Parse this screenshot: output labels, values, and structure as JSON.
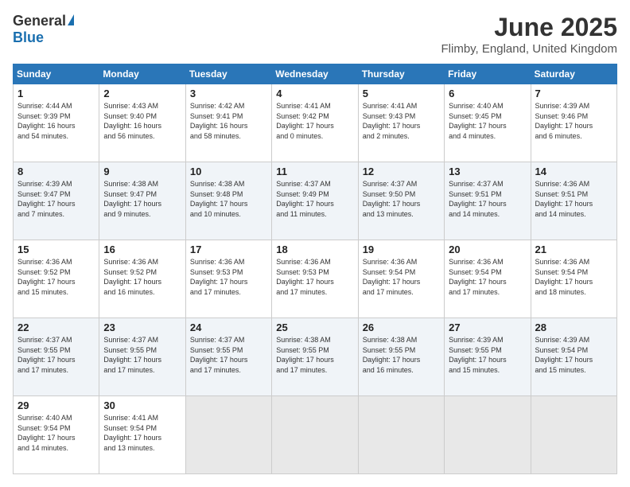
{
  "header": {
    "logo_general": "General",
    "logo_blue": "Blue",
    "title": "June 2025",
    "location": "Flimby, England, United Kingdom"
  },
  "columns": [
    "Sunday",
    "Monday",
    "Tuesday",
    "Wednesday",
    "Thursday",
    "Friday",
    "Saturday"
  ],
  "weeks": [
    [
      {
        "day": "1",
        "text": "Sunrise: 4:44 AM\nSunset: 9:39 PM\nDaylight: 16 hours\nand 54 minutes."
      },
      {
        "day": "2",
        "text": "Sunrise: 4:43 AM\nSunset: 9:40 PM\nDaylight: 16 hours\nand 56 minutes."
      },
      {
        "day": "3",
        "text": "Sunrise: 4:42 AM\nSunset: 9:41 PM\nDaylight: 16 hours\nand 58 minutes."
      },
      {
        "day": "4",
        "text": "Sunrise: 4:41 AM\nSunset: 9:42 PM\nDaylight: 17 hours\nand 0 minutes."
      },
      {
        "day": "5",
        "text": "Sunrise: 4:41 AM\nSunset: 9:43 PM\nDaylight: 17 hours\nand 2 minutes."
      },
      {
        "day": "6",
        "text": "Sunrise: 4:40 AM\nSunset: 9:45 PM\nDaylight: 17 hours\nand 4 minutes."
      },
      {
        "day": "7",
        "text": "Sunrise: 4:39 AM\nSunset: 9:46 PM\nDaylight: 17 hours\nand 6 minutes."
      }
    ],
    [
      {
        "day": "8",
        "text": "Sunrise: 4:39 AM\nSunset: 9:47 PM\nDaylight: 17 hours\nand 7 minutes."
      },
      {
        "day": "9",
        "text": "Sunrise: 4:38 AM\nSunset: 9:47 PM\nDaylight: 17 hours\nand 9 minutes."
      },
      {
        "day": "10",
        "text": "Sunrise: 4:38 AM\nSunset: 9:48 PM\nDaylight: 17 hours\nand 10 minutes."
      },
      {
        "day": "11",
        "text": "Sunrise: 4:37 AM\nSunset: 9:49 PM\nDaylight: 17 hours\nand 11 minutes."
      },
      {
        "day": "12",
        "text": "Sunrise: 4:37 AM\nSunset: 9:50 PM\nDaylight: 17 hours\nand 13 minutes."
      },
      {
        "day": "13",
        "text": "Sunrise: 4:37 AM\nSunset: 9:51 PM\nDaylight: 17 hours\nand 14 minutes."
      },
      {
        "day": "14",
        "text": "Sunrise: 4:36 AM\nSunset: 9:51 PM\nDaylight: 17 hours\nand 14 minutes."
      }
    ],
    [
      {
        "day": "15",
        "text": "Sunrise: 4:36 AM\nSunset: 9:52 PM\nDaylight: 17 hours\nand 15 minutes."
      },
      {
        "day": "16",
        "text": "Sunrise: 4:36 AM\nSunset: 9:52 PM\nDaylight: 17 hours\nand 16 minutes."
      },
      {
        "day": "17",
        "text": "Sunrise: 4:36 AM\nSunset: 9:53 PM\nDaylight: 17 hours\nand 17 minutes."
      },
      {
        "day": "18",
        "text": "Sunrise: 4:36 AM\nSunset: 9:53 PM\nDaylight: 17 hours\nand 17 minutes."
      },
      {
        "day": "19",
        "text": "Sunrise: 4:36 AM\nSunset: 9:54 PM\nDaylight: 17 hours\nand 17 minutes."
      },
      {
        "day": "20",
        "text": "Sunrise: 4:36 AM\nSunset: 9:54 PM\nDaylight: 17 hours\nand 17 minutes."
      },
      {
        "day": "21",
        "text": "Sunrise: 4:36 AM\nSunset: 9:54 PM\nDaylight: 17 hours\nand 18 minutes."
      }
    ],
    [
      {
        "day": "22",
        "text": "Sunrise: 4:37 AM\nSunset: 9:55 PM\nDaylight: 17 hours\nand 17 minutes."
      },
      {
        "day": "23",
        "text": "Sunrise: 4:37 AM\nSunset: 9:55 PM\nDaylight: 17 hours\nand 17 minutes."
      },
      {
        "day": "24",
        "text": "Sunrise: 4:37 AM\nSunset: 9:55 PM\nDaylight: 17 hours\nand 17 minutes."
      },
      {
        "day": "25",
        "text": "Sunrise: 4:38 AM\nSunset: 9:55 PM\nDaylight: 17 hours\nand 17 minutes."
      },
      {
        "day": "26",
        "text": "Sunrise: 4:38 AM\nSunset: 9:55 PM\nDaylight: 17 hours\nand 16 minutes."
      },
      {
        "day": "27",
        "text": "Sunrise: 4:39 AM\nSunset: 9:55 PM\nDaylight: 17 hours\nand 15 minutes."
      },
      {
        "day": "28",
        "text": "Sunrise: 4:39 AM\nSunset: 9:54 PM\nDaylight: 17 hours\nand 15 minutes."
      }
    ],
    [
      {
        "day": "29",
        "text": "Sunrise: 4:40 AM\nSunset: 9:54 PM\nDaylight: 17 hours\nand 14 minutes."
      },
      {
        "day": "30",
        "text": "Sunrise: 4:41 AM\nSunset: 9:54 PM\nDaylight: 17 hours\nand 13 minutes."
      },
      {
        "day": "",
        "text": ""
      },
      {
        "day": "",
        "text": ""
      },
      {
        "day": "",
        "text": ""
      },
      {
        "day": "",
        "text": ""
      },
      {
        "day": "",
        "text": ""
      }
    ]
  ]
}
